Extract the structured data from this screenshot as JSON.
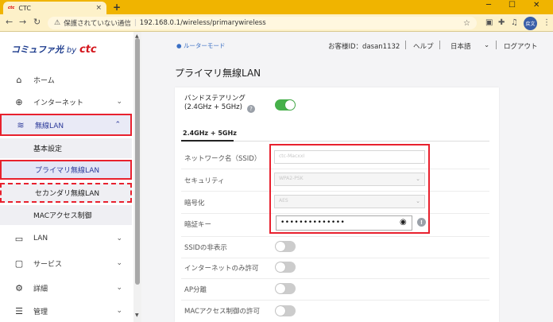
{
  "browser": {
    "tab_favicon": "ctc",
    "tab_title": "CTC",
    "tab_close": "×",
    "new_tab": "+",
    "security_warning": "保護されていない通信",
    "url": "192.168.0.1/wireless/primarywireless",
    "profile_label": "戻文"
  },
  "brand": {
    "logo_text": "コミュファ光",
    "logo_by": "by",
    "logo_ctc": "ctc"
  },
  "sidebar": {
    "items": [
      {
        "label": "ホーム",
        "icon": "home-icon"
      },
      {
        "label": "インターネット",
        "icon": "globe-icon"
      },
      {
        "label": "無線LAN",
        "icon": "wifi-icon"
      },
      {
        "label": "LAN",
        "icon": "monitor-icon"
      },
      {
        "label": "サービス",
        "icon": "chat-icon"
      },
      {
        "label": "詳細",
        "icon": "gear-icon"
      },
      {
        "label": "管理",
        "icon": "sliders-icon"
      }
    ],
    "wireless_submenu": [
      {
        "label": "基本設定"
      },
      {
        "label": "プライマリ無線LAN"
      },
      {
        "label": "セカンダリ無線LAN"
      },
      {
        "label": "MACアクセス制御"
      }
    ]
  },
  "header": {
    "router_mode": "ルーターモード",
    "customer_id": "お客様ID：dasan1132",
    "help": "ヘルプ",
    "language": "日本語",
    "logout": "ログアウト"
  },
  "page": {
    "title": "プライマリ無線LAN",
    "band_steering_label_1": "バンドステアリング",
    "band_steering_label_2": "(2.4GHz + 5GHz)",
    "band_steering_on": true,
    "subtab": "2.4GHz + 5GHz",
    "fields": {
      "ssid_label": "ネットワーク名（SSID）",
      "ssid_value": "ctc-MacxxI",
      "security_label": "セキュリティ",
      "security_value": "WPA2-PSK",
      "encryption_label": "暗号化",
      "encryption_value": "AES",
      "key_label": "暗証キー",
      "key_value": "••••••••••••••"
    },
    "toggles": [
      {
        "label": "SSIDの非表示",
        "on": false
      },
      {
        "label": "インターネットのみ許可",
        "on": false
      },
      {
        "label": "AP分離",
        "on": false
      },
      {
        "label": "MACアクセス制御の許可",
        "on": false
      }
    ]
  },
  "colors": {
    "brand_blue": "#1b3a8c",
    "accent_red": "#e8212e",
    "toggle_on": "#46b04a",
    "browser_bar": "#f0b400"
  }
}
